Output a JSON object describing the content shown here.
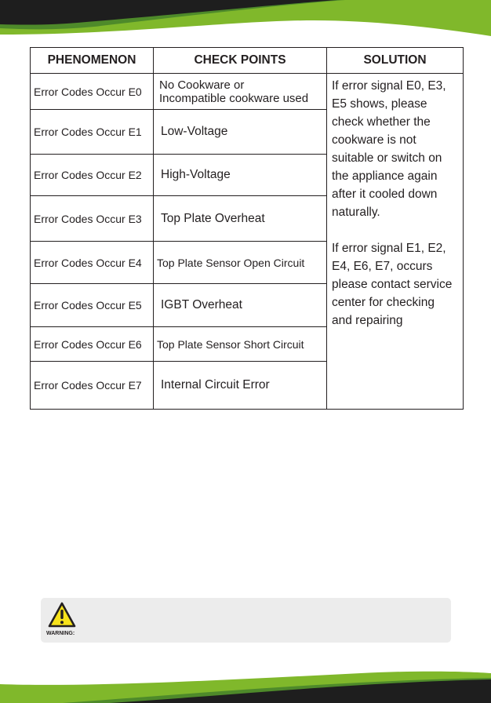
{
  "table": {
    "headers": {
      "phenomenon": "PHENOMENON",
      "check_points": "CHECK POINTS",
      "solution": "SOLUTION"
    },
    "rows": [
      {
        "phenomenon": "Error Codes Occur E0",
        "check_line1": "No Cookware or",
        "check_line2": "Incompatible cookware used"
      },
      {
        "phenomenon": "Error Codes Occur E1",
        "check": "Low-Voltage"
      },
      {
        "phenomenon": "Error Codes Occur E2",
        "check": "High-Voltage"
      },
      {
        "phenomenon": "Error Codes Occur E3",
        "check": "Top Plate Overheat"
      },
      {
        "phenomenon": "Error Codes Occur E4",
        "check": "Top Plate Sensor Open Circuit"
      },
      {
        "phenomenon": "Error Codes Occur E5",
        "check": "IGBT Overheat"
      },
      {
        "phenomenon": "Error Codes Occur E6",
        "check": "Top Plate Sensor Short Circuit"
      },
      {
        "phenomenon": "Error Codes Occur E7",
        "check": "Internal Circuit Error"
      }
    ],
    "solution": {
      "paragraph1": "If error signal E0, E3, E5 shows, please check whether the cookware is not suitable or switch on the appliance again after it cooled down naturally.",
      "paragraph2": "If error signal E1, E2, E4, E6, E7, occurs please contact service center for checking and repairing"
    }
  },
  "warning": {
    "label": "WARNING:",
    "icon": "warning-triangle-icon"
  },
  "colors": {
    "brand_green": "#80b82b",
    "dark_green": "#4e8a2a",
    "dark": "#1e1e1e",
    "warning_yellow": "#f7e21b",
    "warning_bg": "#ececec"
  }
}
